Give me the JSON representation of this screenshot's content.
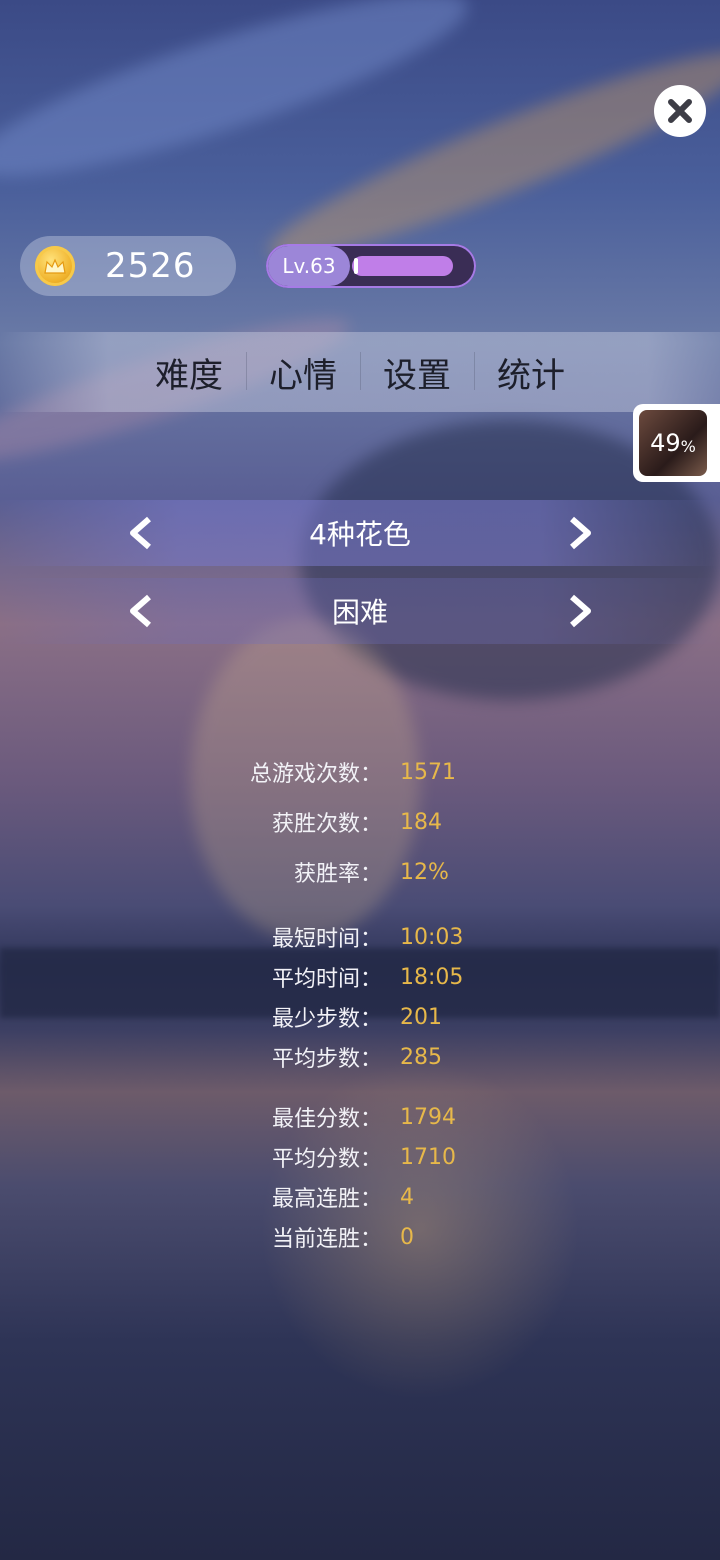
{
  "header": {
    "coins": "2526",
    "level_label": "Lv.63",
    "level_progress": 0.9
  },
  "tabs": [
    {
      "label": "难度"
    },
    {
      "label": "心情"
    },
    {
      "label": "设置"
    },
    {
      "label": "统计"
    }
  ],
  "thumbnail": {
    "percent_number": "49",
    "percent_sign": "%"
  },
  "selectors": {
    "suits": "4种花色",
    "difficulty": "困难"
  },
  "stats": [
    {
      "label": "总游戏次数：",
      "value": "1571"
    },
    {
      "label": "获胜次数：",
      "value": "184"
    },
    {
      "label": "获胜率：",
      "value": "12%"
    },
    {
      "label": "最短时间：",
      "value": "10:03"
    },
    {
      "label": "平均时间：",
      "value": "18:05"
    },
    {
      "label": "最少步数：",
      "value": "201"
    },
    {
      "label": "平均步数：",
      "value": "285"
    },
    {
      "label": "最佳分数：",
      "value": "1794"
    },
    {
      "label": "平均分数：",
      "value": "1710"
    },
    {
      "label": "最高连胜：",
      "value": "4"
    },
    {
      "label": "当前连胜：",
      "value": "0"
    }
  ],
  "colors": {
    "accent_gold": "#e7b84a",
    "level_purple": "#c07ee8"
  }
}
